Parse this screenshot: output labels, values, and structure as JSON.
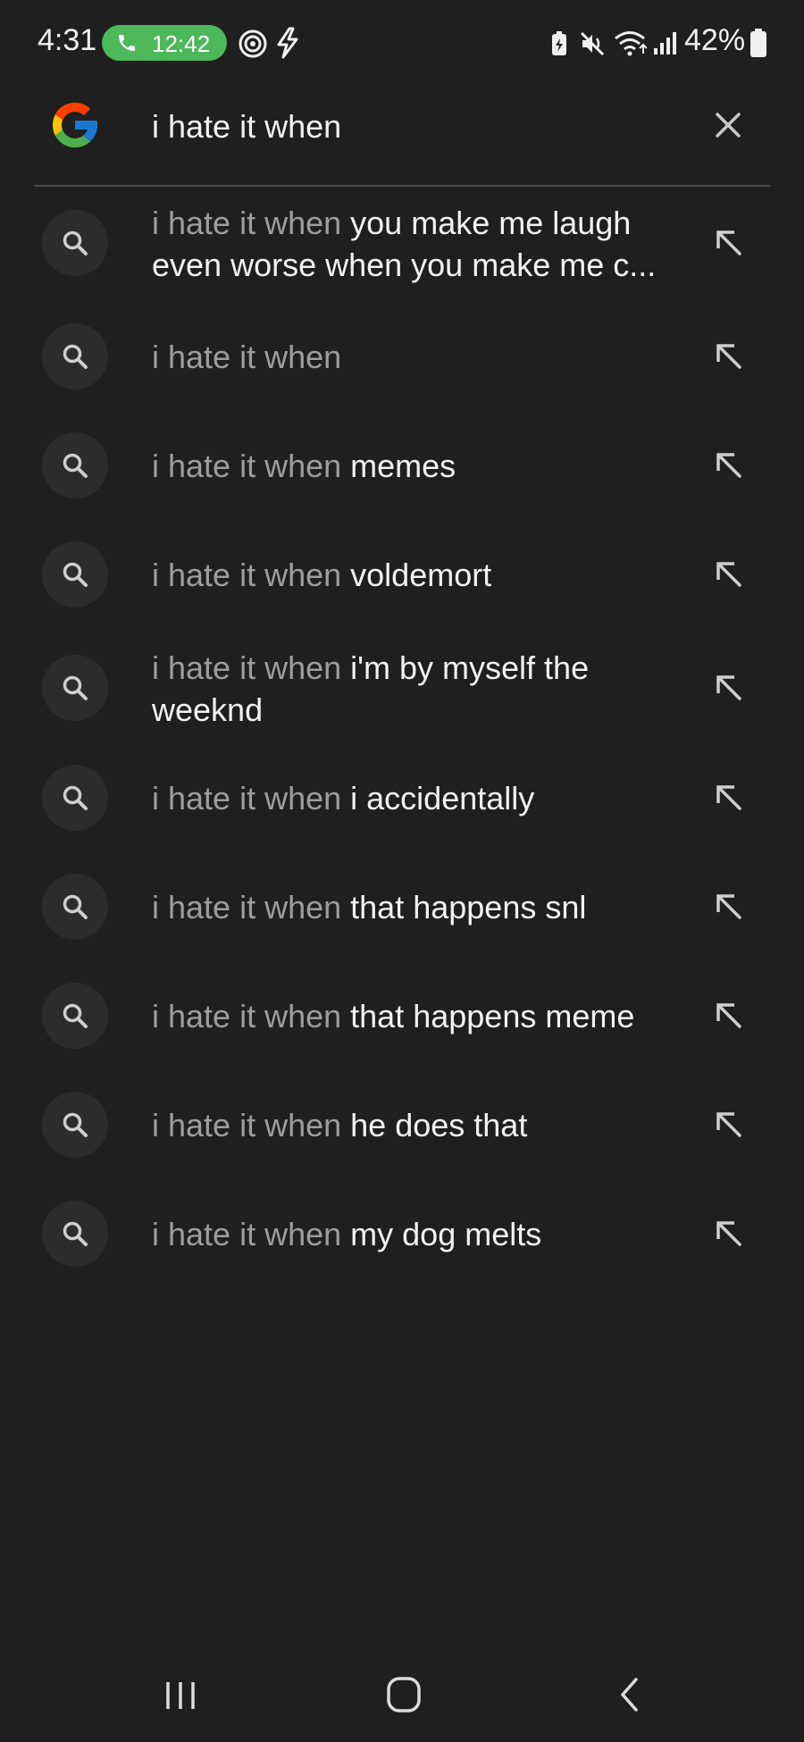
{
  "status_bar": {
    "time": "4:31",
    "call_timer": "12:42",
    "battery_percent": "42%",
    "icons": [
      "phone-icon",
      "hotspot-icon",
      "flash-icon",
      "battery-saver-icon",
      "mute-icon",
      "wifi-icon",
      "signal-icon",
      "battery-icon"
    ]
  },
  "search": {
    "query": "i hate it when",
    "logo": "G",
    "clear_icon": "close-icon"
  },
  "suggestions": [
    {
      "prefix": "i hate it when",
      "completion": "you make me laugh even worse when you make me c..."
    },
    {
      "prefix": "i hate it when",
      "completion": ""
    },
    {
      "prefix": "i hate it when",
      "completion": "memes"
    },
    {
      "prefix": "i hate it when",
      "completion": "voldemort"
    },
    {
      "prefix": "i hate it when",
      "completion": "i'm by myself the weeknd"
    },
    {
      "prefix": "i hate it when",
      "completion": "i accidentally"
    },
    {
      "prefix": "i hate it when",
      "completion": "that happens snl"
    },
    {
      "prefix": "i hate it when",
      "completion": "that happens meme"
    },
    {
      "prefix": "i hate it when",
      "completion": "he does that"
    },
    {
      "prefix": "i hate it when",
      "completion": "my dog melts"
    }
  ],
  "nav_bar": {
    "icons": [
      "recent-apps-icon",
      "home-icon",
      "back-icon"
    ]
  },
  "colors": {
    "background": "#1f1f1f",
    "call_pill": "#4cb85a",
    "prefix_text": "#9d9d9d",
    "completion_text": "#f2f2f2",
    "google_blue": "#4285F4",
    "google_red": "#EA4335",
    "google_yellow": "#FBBC05",
    "google_green": "#34A853"
  }
}
